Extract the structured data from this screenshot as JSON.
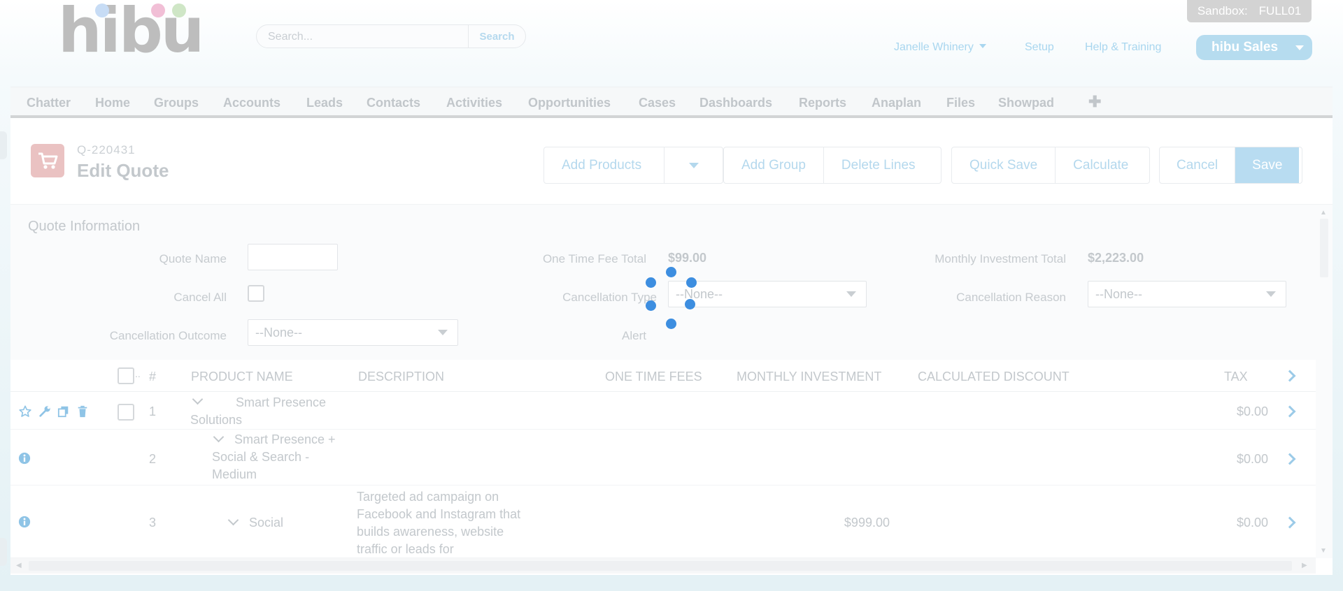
{
  "header": {
    "logo_text": "hibu",
    "logo_dot_colors": [
      "#c7dcf5",
      "#f1bfd6",
      "#cfe6c6"
    ],
    "search": {
      "placeholder": "Search...",
      "button_label": "Search"
    },
    "sandbox": {
      "label": "Sandbox:",
      "name": "FULL01"
    },
    "user_menu": "Janelle Whinery",
    "setup": "Setup",
    "help": "Help & Training",
    "app_switcher": "hibu Sales"
  },
  "tabs": [
    "Chatter",
    "Home",
    "Groups",
    "Accounts",
    "Leads",
    "Contacts",
    "Activities",
    "Opportunities",
    "Cases",
    "Dashboards",
    "Reports",
    "Anaplan",
    "Files",
    "Showpad"
  ],
  "page": {
    "quote_number": "Q-220431",
    "title": "Edit Quote",
    "icon": "shopping-cart-icon",
    "buttons": {
      "add_products": "Add Products",
      "add_group": "Add Group",
      "delete_lines": "Delete Lines",
      "quick_save": "Quick Save",
      "calculate": "Calculate",
      "cancel": "Cancel",
      "save": "Save"
    }
  },
  "quote_info": {
    "section_title": "Quote Information",
    "quote_name_label": "Quote Name",
    "quote_name_value": "",
    "cancel_all_label": "Cancel All",
    "cancellation_outcome_label": "Cancellation Outcome",
    "cancellation_outcome_value": "--None--",
    "one_time_fee_total_label": "One Time Fee Total",
    "one_time_fee_total_value": "$99.00",
    "cancellation_type_label": "Cancellation Type",
    "cancellation_type_value": "--None--",
    "alert_label": "Alert",
    "monthly_investment_total_label": "Monthly Investment Total",
    "monthly_investment_total_value": "$2,223.00",
    "cancellation_reason_label": "Cancellation Reason",
    "cancellation_reason_value": "--None--"
  },
  "table": {
    "columns": {
      "select": "..",
      "num": "#",
      "product_name": "PRODUCT NAME",
      "description": "DESCRIPTION",
      "one_time_fees": "ONE TIME FEES",
      "monthly_investment": "MONTHLY INVESTMENT",
      "calculated_discount": "CALCULATED DISCOUNT",
      "tax": "TAX"
    },
    "rows": [
      {
        "num": "1",
        "product_name": "Smart Presence Solutions",
        "description": "",
        "one_time_fees": "",
        "monthly_investment": "",
        "tax": "$0.00"
      },
      {
        "num": "2",
        "product_name": "Smart Presence + Social & Search - Medium",
        "description": "",
        "one_time_fees": "",
        "monthly_investment": "",
        "tax": "$0.00"
      },
      {
        "num": "3",
        "product_name": "Social",
        "description": "Targeted ad campaign on Facebook and Instagram that builds awareness, website traffic or leads for",
        "one_time_fees": "",
        "monthly_investment": "$999.00",
        "tax": "$0.00"
      }
    ]
  },
  "colors": {
    "spinner": "#3d8ee0",
    "link": "#a9d6ef",
    "accent_button": "#b8dcf1"
  }
}
